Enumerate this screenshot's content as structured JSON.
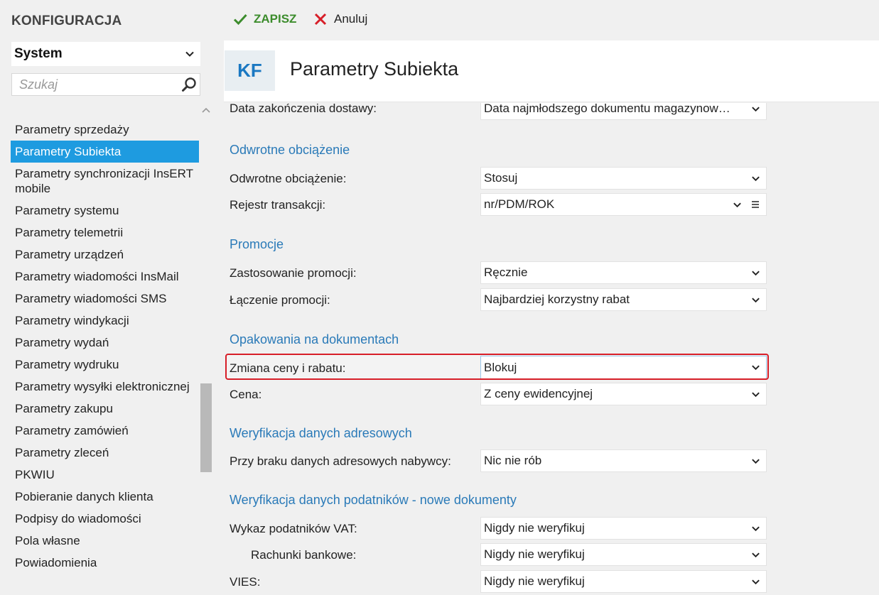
{
  "app": {
    "title": "KONFIGURACJA"
  },
  "module": {
    "selected": "System"
  },
  "search": {
    "placeholder": "Szukaj"
  },
  "sidebar": {
    "items": [
      {
        "label": "Parametry sprzedaży"
      },
      {
        "label": "Parametry Subiekta",
        "active": true
      },
      {
        "label": "Parametry synchronizacji InsERT mobile"
      },
      {
        "label": "Parametry systemu"
      },
      {
        "label": "Parametry telemetrii"
      },
      {
        "label": "Parametry urządzeń"
      },
      {
        "label": "Parametry wiadomości InsMail"
      },
      {
        "label": "Parametry wiadomości SMS"
      },
      {
        "label": "Parametry windykacji"
      },
      {
        "label": "Parametry wydań"
      },
      {
        "label": "Parametry wydruku"
      },
      {
        "label": "Parametry wysyłki elektronicznej"
      },
      {
        "label": "Parametry zakupu"
      },
      {
        "label": "Parametry zamówień"
      },
      {
        "label": "Parametry zleceń"
      },
      {
        "label": "PKWIU"
      },
      {
        "label": "Pobieranie danych klienta"
      },
      {
        "label": "Podpisy do wiadomości"
      },
      {
        "label": "Pola własne"
      },
      {
        "label": "Powiadomienia"
      }
    ]
  },
  "toolbar": {
    "save_label": "ZAPISZ",
    "cancel_label": "Anuluj"
  },
  "header": {
    "badge": "KF",
    "title": "Parametry Subiekta"
  },
  "form": {
    "partial_row": {
      "label": "Data zakończenia dostawy:",
      "value": "Data najmłodszego dokumentu magazynow…"
    },
    "sections": {
      "reverse_charge": "Odwrotne obciążenie",
      "promotions": "Promocje",
      "packaging": "Opakowania na dokumentach",
      "address_verification": "Weryfikacja danych adresowych",
      "taxpayer_verification": "Weryfikacja danych podatników - nowe dokumenty"
    },
    "rows": {
      "reverse_charge": {
        "label": "Odwrotne obciążenie:",
        "value": "Stosuj"
      },
      "transaction_register": {
        "label": "Rejestr transakcji:",
        "value": "nr/PDM/ROK"
      },
      "promo_usage": {
        "label": "Zastosowanie promocji:",
        "value": "Ręcznie"
      },
      "promo_combining": {
        "label": "Łączenie promocji:",
        "value": "Najbardziej korzystny rabat"
      },
      "price_discount_change": {
        "label": "Zmiana ceny i rabatu:",
        "value": "Blokuj"
      },
      "price": {
        "label": "Cena:",
        "value": "Z ceny ewidencyjnej"
      },
      "missing_address": {
        "label": "Przy braku danych adresowych nabywcy:",
        "value": "Nic nie rób"
      },
      "vat_registry": {
        "label": "Wykaz podatników VAT:",
        "value": "Nigdy nie weryfikuj"
      },
      "bank_accounts": {
        "label": "Rachunki bankowe:",
        "value": "Nigdy nie weryfikuj"
      },
      "vies": {
        "label": "VIES:",
        "value": "Nigdy nie weryfikuj"
      }
    }
  },
  "colors": {
    "accent": "#1e9be0",
    "section_title": "#2a7ab8",
    "save_green": "#3c8c2c",
    "cancel_red": "#d71e28",
    "highlight_border": "#d71e28"
  }
}
